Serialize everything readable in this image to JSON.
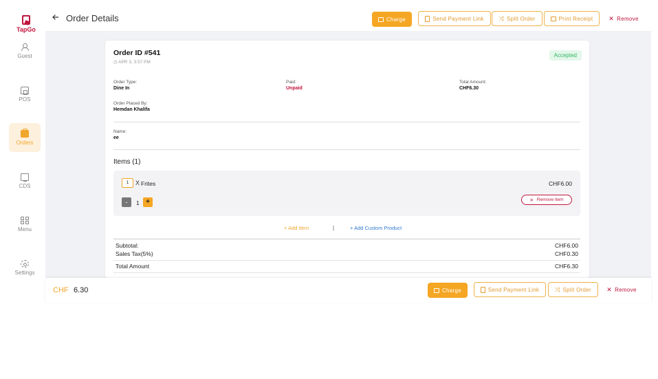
{
  "app": {
    "logo_text": "TapGo"
  },
  "sidebar": {
    "items": [
      {
        "label": "Guest",
        "icon": "guest-icon"
      },
      {
        "label": "POS",
        "icon": "store-icon"
      },
      {
        "label": "Orders",
        "icon": "bag-icon",
        "active": true
      },
      {
        "label": "CDS",
        "icon": "monitor-icon"
      },
      {
        "label": "Menu",
        "icon": "grid-icon"
      },
      {
        "label": "Settings",
        "icon": "gear-icon"
      }
    ]
  },
  "header": {
    "title": "Order Details",
    "actions": {
      "charge": "Charge",
      "send_payment_link": "Send Payment Link",
      "split_order": "Split Order",
      "print_receipt": "Print Receipt",
      "remove": "Remove"
    }
  },
  "order": {
    "id": "Order ID #541",
    "date": "APR 3, 3:57 PM",
    "status": "Accepted",
    "order_type_label": "Order Type:",
    "order_type": "Dine In",
    "paid_label": "Paid:",
    "paid": "Unpaid",
    "total_amount_label": "Total Amount:",
    "total_amount": "CHF6.30",
    "placed_by_label": "Order Placed By:",
    "placed_by": "Hemdan Khalifa",
    "name_label": "Name:",
    "name": "ee"
  },
  "items": {
    "title": "Items (1)",
    "list": [
      {
        "qty": "1",
        "x": "X",
        "name": "Frites",
        "price": "CHF6.00",
        "stepper_qty": "1",
        "remove_label": "Remove Item"
      }
    ],
    "add_item": "Add Item",
    "separator": "|",
    "add_custom_product": "Add Custom Product"
  },
  "summary": {
    "subtotal_label": "Subtotal:",
    "subtotal": "CHF6.00",
    "tax_label": "Sales Tax(5%)",
    "tax": "CHF0.30",
    "total_label": "Total Amount",
    "total": "CHF6.30"
  },
  "footer": {
    "currency": "CHF",
    "amount": "6.30",
    "actions": {
      "charge": "Charge",
      "send_payment_link": "Send Payment Link",
      "split_order": "Split Order",
      "remove": "Remove"
    }
  },
  "colors": {
    "accent": "#f5a623",
    "brand": "#c0143c",
    "success": "#35b563",
    "link": "#2e7bcf"
  }
}
